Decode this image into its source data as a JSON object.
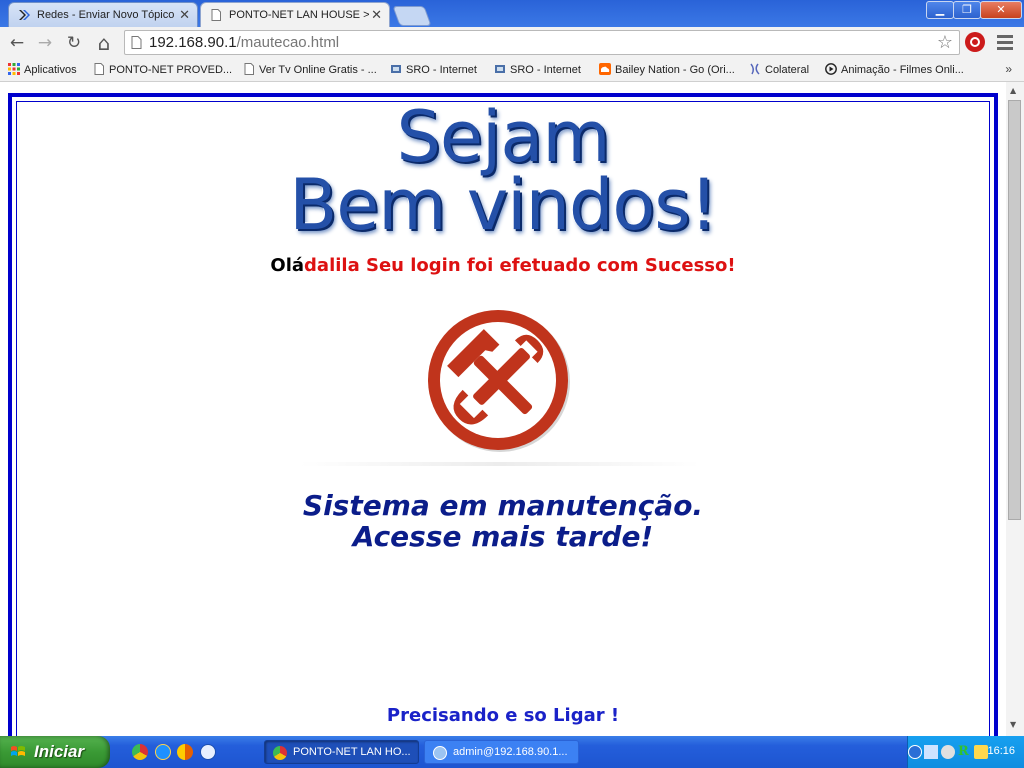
{
  "browser": {
    "tabs": [
      {
        "label": "Redes - Enviar Novo Tópico",
        "close": "✕"
      },
      {
        "label": "PONTO-NET LAN HOUSE > Ma",
        "close": "✕"
      }
    ],
    "window_buttons": {
      "minimize": "▁",
      "maximize": "❐",
      "close": "✕"
    },
    "nav": {
      "back": "←",
      "forward": "→",
      "reload": "↻",
      "home": "⌂"
    },
    "url_host": "192.168.90.1",
    "url_path": "/mautecao.html",
    "bookmarks": [
      "Aplicativos",
      "PONTO-NET PROVED...",
      "Ver Tv Online Gratis - ...",
      "SRO - Internet",
      "SRO - Internet",
      "Bailey Nation - Go (Ori...",
      "Colateral",
      "Animação - Filmes Onli..."
    ],
    "bookmarks_more": "»"
  },
  "page": {
    "welcome_line1": "Sejam",
    "welcome_line2": "Bem vindos!",
    "greeting_hello": "Olá",
    "greeting_user": "dalila",
    "greeting_message": " Seu login foi efetuado com Sucesso!",
    "maintenance_line1": "Sistema em manutenção.",
    "maintenance_line2": "Acesse mais tarde!",
    "call_text": "Precisando e so Ligar !"
  },
  "colors": {
    "frame_border": "#0000cc",
    "greeting_red": "#dd1111",
    "maintenance_blue": "#0b1d8a",
    "call_blue": "#1a22c8",
    "icon_red": "#c0341c"
  },
  "taskbar": {
    "start_label": "Iniciar",
    "tasks": [
      {
        "label": "PONTO-NET LAN HO..."
      },
      {
        "label": "admin@192.168.90.1..."
      }
    ],
    "clock": "16:16"
  }
}
